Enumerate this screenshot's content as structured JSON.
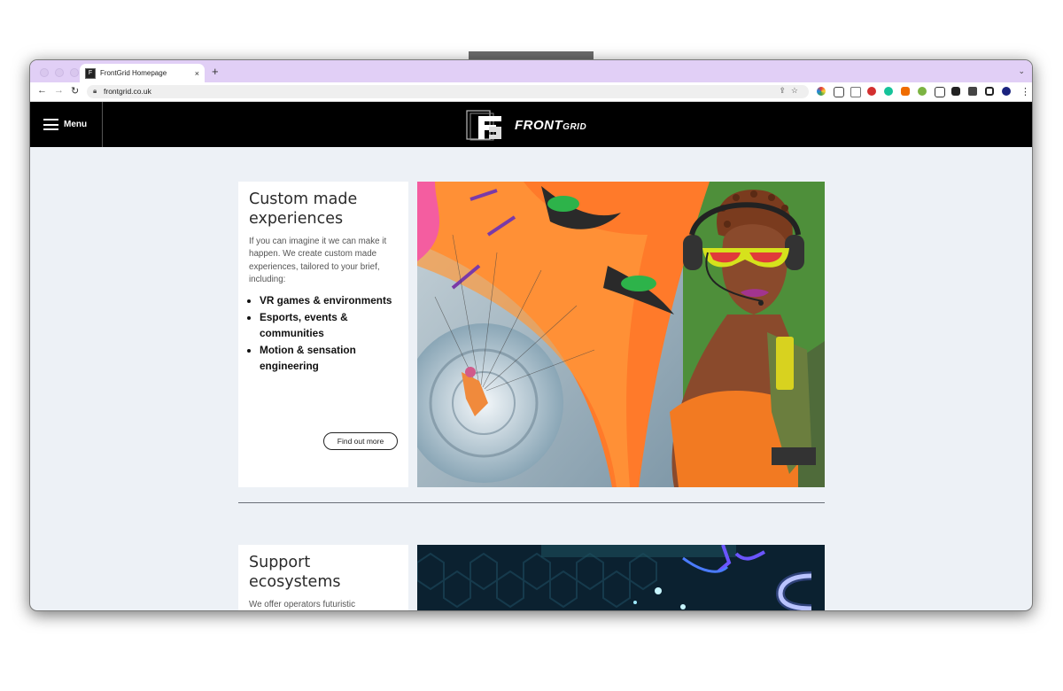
{
  "browser": {
    "tab_title": "FrontGrid Homepage",
    "tab_close": "×",
    "new_tab": "+",
    "url": "frontgrid.co.uk"
  },
  "site_header": {
    "menu_label": "Menu",
    "logo_main": "FRONT",
    "logo_sub": "GRID"
  },
  "sections": [
    {
      "title": "Custom made experiences",
      "body": "If you can imagine it we can make it happen. We create custom made experiences, tailored to your brief, including:",
      "bullets": [
        "VR games & environments",
        "Esports, events & communities",
        "Motion & sensation engineering"
      ],
      "button_label": "Find out more"
    },
    {
      "title": "Support ecosystems",
      "body": "We offer operators futuristic"
    }
  ]
}
